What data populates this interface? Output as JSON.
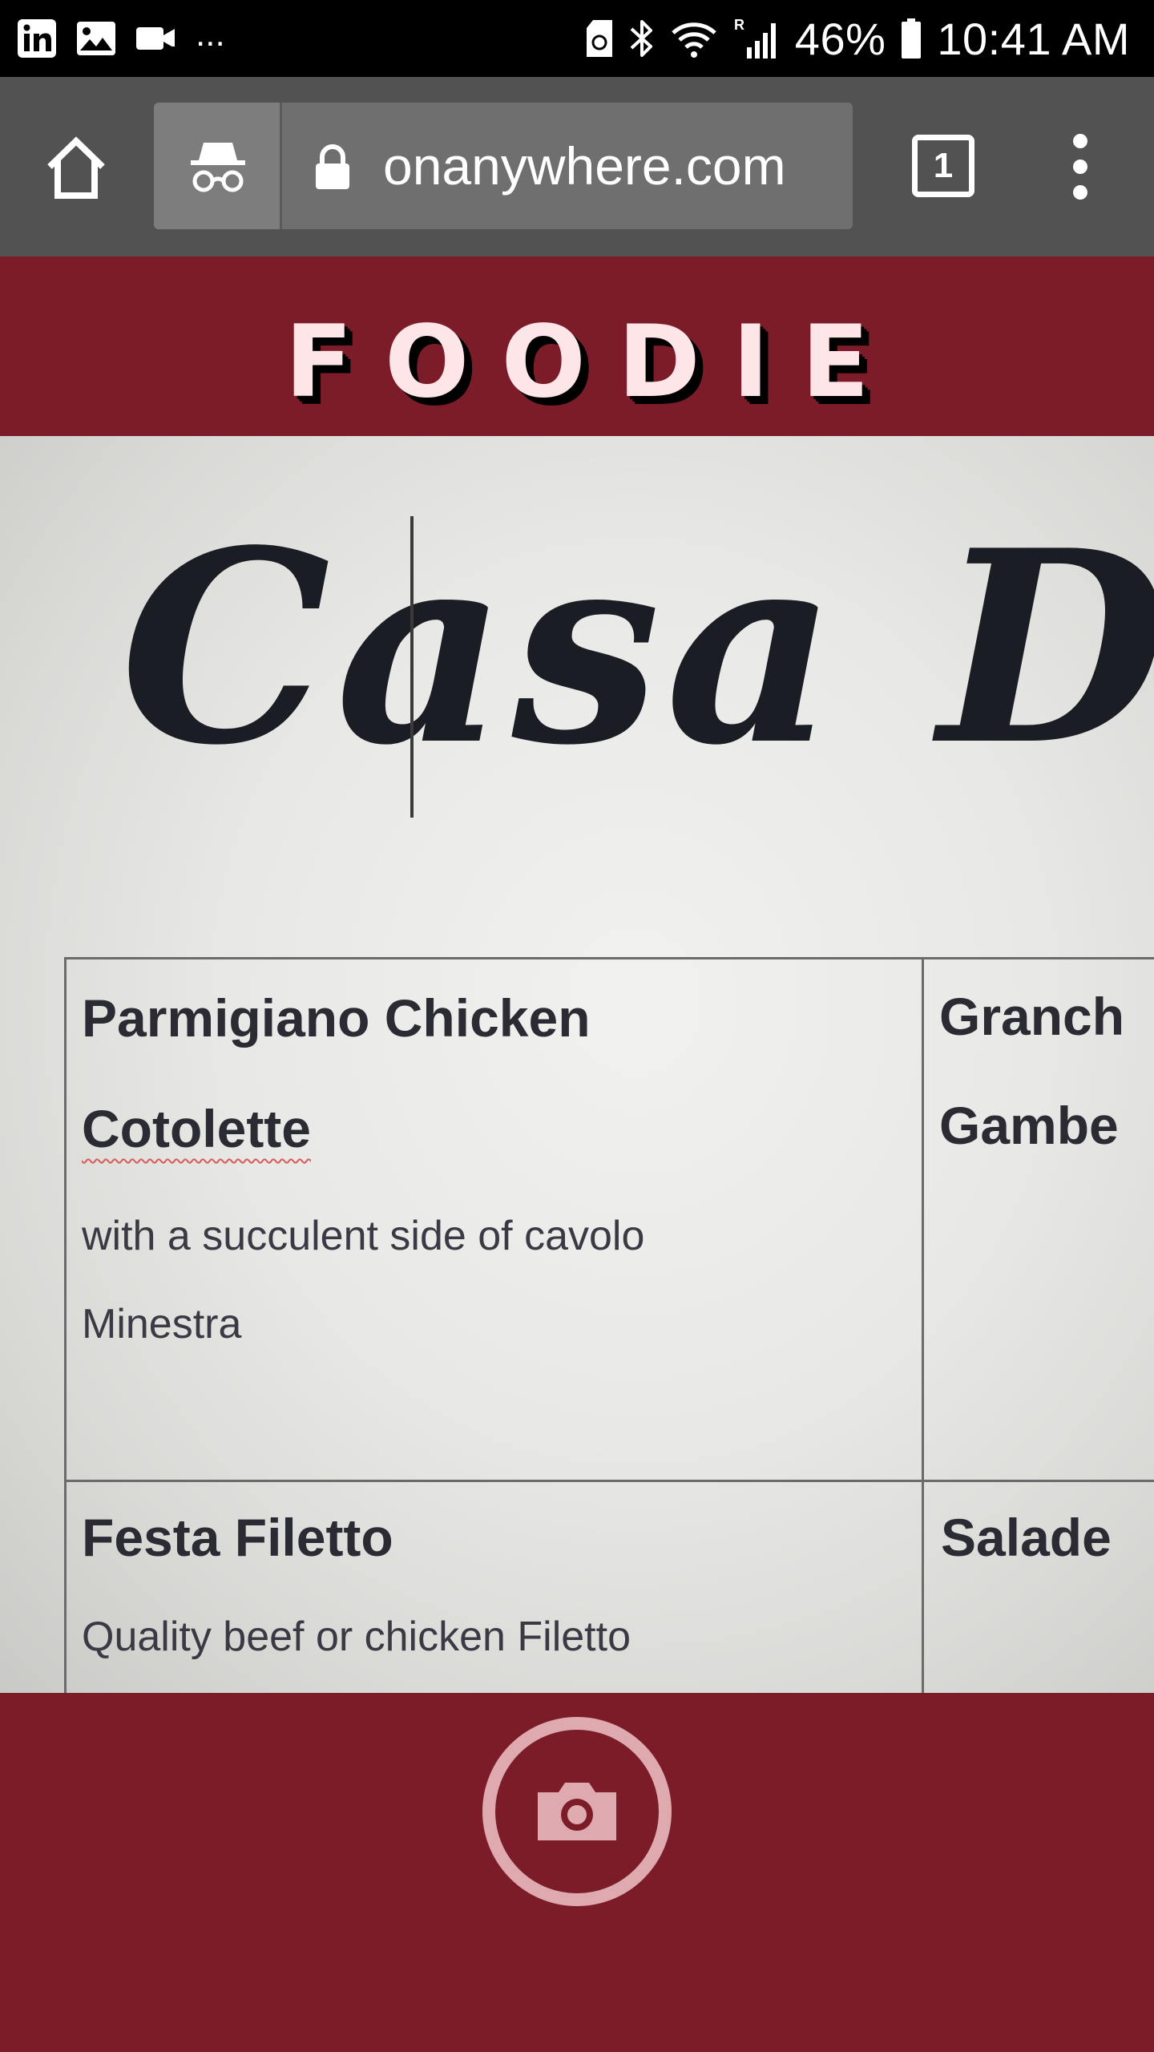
{
  "status_bar": {
    "battery": "46%",
    "time": "10:41 AM",
    "more": "...",
    "icons": [
      "linkedin-icon",
      "gallery-icon",
      "video-call-icon",
      "sd-card-icon",
      "bluetooth-icon",
      "wifi-icon",
      "signal-icon",
      "battery-icon"
    ]
  },
  "browser": {
    "url": "onanywhere.com",
    "tab_count": "1",
    "icons": [
      "home-icon",
      "incognito-icon",
      "lock-icon",
      "more-vert-icon"
    ]
  },
  "app": {
    "brand": "FOODIE"
  },
  "camera_preview": {
    "menu_title": "Casa Di F",
    "items": [
      {
        "name_line1": "Parmigiano Chicken",
        "name_line2": "Cotolette",
        "desc_line1": "with a succulent side of cavolo",
        "desc_line2": "Minestra"
      },
      {
        "name_line1": "Granch",
        "name_line2": "Gambe"
      },
      {
        "name_line1": "Festa Filetto",
        "desc_line1": "Quality beef or chicken Filetto"
      },
      {
        "name_line1": "Salade"
      }
    ]
  },
  "capture": {
    "icon": "camera-icon"
  },
  "colors": {
    "brand_bg": "#7c1c28",
    "brand_text": "#fde5e8",
    "capture_ring": "#dfa9b0"
  }
}
